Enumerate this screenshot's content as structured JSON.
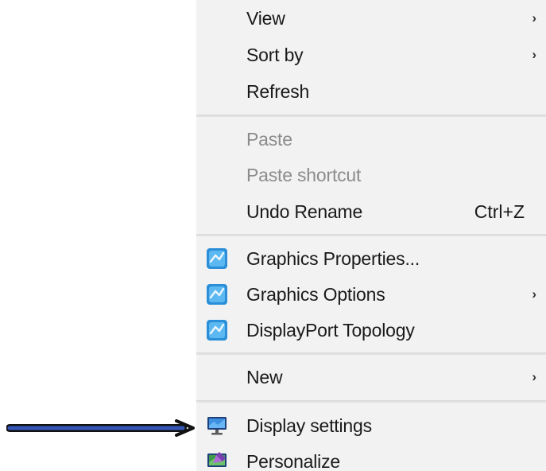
{
  "context_menu": {
    "items": [
      {
        "label": "View",
        "submenu": true,
        "disabled": false
      },
      {
        "label": "Sort by",
        "submenu": true,
        "disabled": false
      },
      {
        "label": "Refresh",
        "submenu": false,
        "disabled": false
      },
      {
        "label": "Paste",
        "submenu": false,
        "disabled": true
      },
      {
        "label": "Paste shortcut",
        "submenu": false,
        "disabled": true
      },
      {
        "label": "Undo Rename",
        "shortcut": "Ctrl+Z",
        "submenu": false,
        "disabled": false
      },
      {
        "label": "Graphics Properties...",
        "icon": "intel-graphics-icon",
        "submenu": false,
        "disabled": false
      },
      {
        "label": "Graphics Options",
        "icon": "intel-graphics-icon",
        "submenu": true,
        "disabled": false
      },
      {
        "label": "DisplayPort Topology",
        "icon": "intel-graphics-icon",
        "submenu": false,
        "disabled": false
      },
      {
        "label": "New",
        "submenu": true,
        "disabled": false
      },
      {
        "label": "Display settings",
        "icon": "display-monitor-icon",
        "submenu": false,
        "disabled": false
      },
      {
        "label": "Personalize",
        "icon": "personalize-icon",
        "submenu": false,
        "disabled": false
      }
    ],
    "submenu_glyph": "›"
  },
  "colors": {
    "menu_background": "#f2f2f2",
    "separator": "#e1e1e1",
    "disabled_text": "#8c8c8c",
    "annotation_arrow": "#1f3f8f"
  }
}
